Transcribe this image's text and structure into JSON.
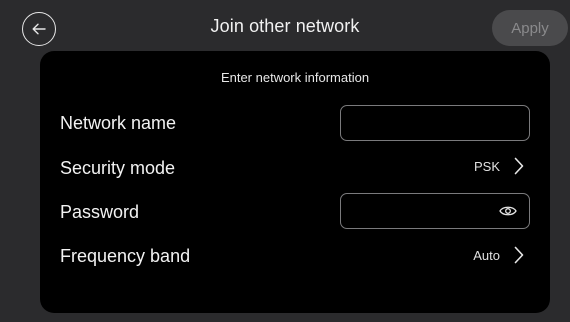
{
  "header": {
    "title": "Join other network",
    "apply_label": "Apply"
  },
  "card": {
    "heading": "Enter network information",
    "rows": [
      {
        "label": "Network name",
        "type": "text-field",
        "value": ""
      },
      {
        "label": "Security mode",
        "type": "select",
        "value": "PSK"
      },
      {
        "label": "Password",
        "type": "password-field",
        "value": ""
      },
      {
        "label": "Frequency band",
        "type": "select",
        "value": "Auto"
      }
    ]
  },
  "icons": {
    "back": "arrow-left-icon",
    "password_toggle": "eye-icon",
    "select": "chevron-right-icon"
  },
  "colors": {
    "background": "#2b2b2d",
    "card": "#000000",
    "apply_disabled_bg": "#4a4a4c",
    "apply_disabled_text": "#8a8a8c",
    "field_border": "#7a7a7c"
  }
}
